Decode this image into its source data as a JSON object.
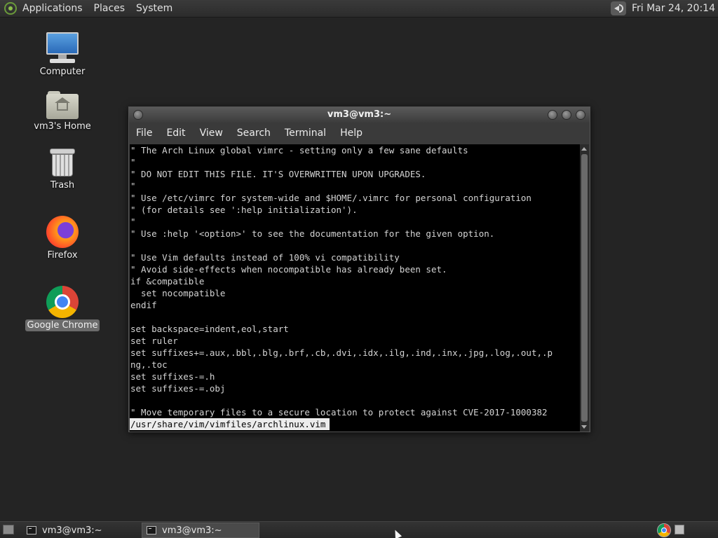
{
  "top_panel": {
    "menus": [
      "Applications",
      "Places",
      "System"
    ],
    "clock": "Fri Mar 24, 20:14"
  },
  "desktop_icons": [
    {
      "label": "Computer"
    },
    {
      "label": "vm3's Home"
    },
    {
      "label": "Trash"
    },
    {
      "label": "Firefox"
    },
    {
      "label": "Google Chrome"
    }
  ],
  "window": {
    "title": "vm3@vm3:~",
    "menus": [
      "File",
      "Edit",
      "View",
      "Search",
      "Terminal",
      "Help"
    ],
    "lines": [
      "\" The Arch Linux global vimrc - setting only a few sane defaults",
      "\"",
      "\" DO NOT EDIT THIS FILE. IT'S OVERWRITTEN UPON UPGRADES.",
      "\"",
      "\" Use /etc/vimrc for system-wide and $HOME/.vimrc for personal configuration",
      "\" (for details see ':help initialization').",
      "\"",
      "\" Use :help '<option>' to see the documentation for the given option.",
      "",
      "\" Use Vim defaults instead of 100% vi compatibility",
      "\" Avoid side-effects when nocompatible has already been set.",
      "if &compatible",
      "  set nocompatible",
      "endif",
      "",
      "set backspace=indent,eol,start",
      "set ruler",
      "set suffixes+=.aux,.bbl,.blg,.brf,.cb,.dvi,.idx,.ilg,.ind,.inx,.jpg,.log,.out,.p",
      "ng,.toc",
      "set suffixes-=.h",
      "set suffixes-=.obj",
      "",
      "\" Move temporary files to a secure location to protect against CVE-2017-1000382"
    ],
    "status_line": "/usr/share/vim/vimfiles/archlinux.vim"
  },
  "bottom_panel": {
    "tasks": [
      {
        "label": "vm3@vm3:~"
      },
      {
        "label": "vm3@vm3:~"
      }
    ]
  }
}
